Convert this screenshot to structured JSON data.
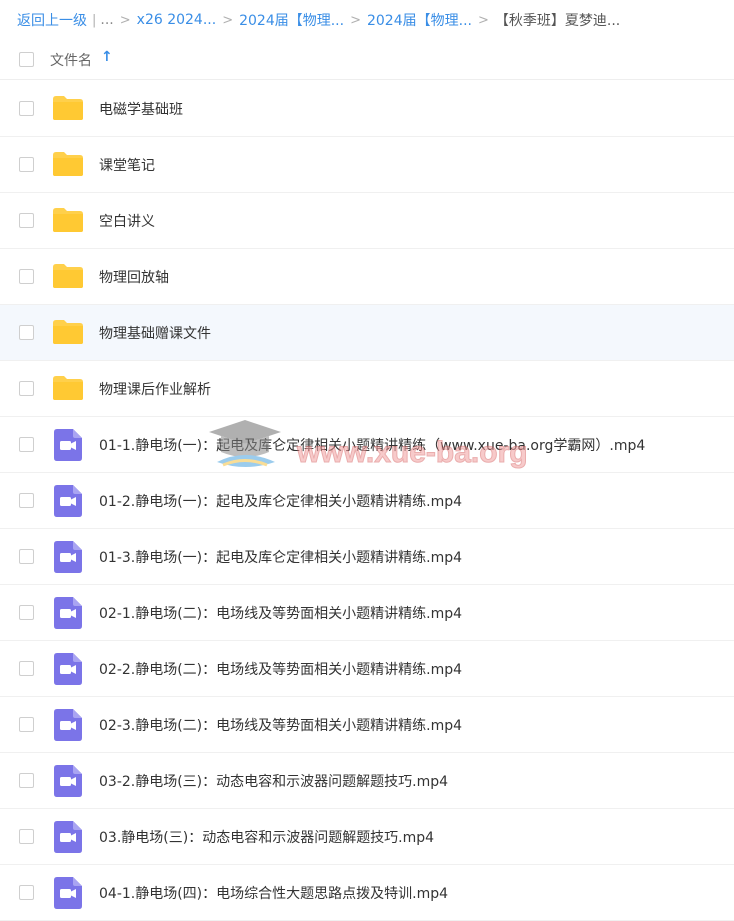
{
  "breadcrumb": {
    "back": "返回上一级",
    "ellipsis": "...",
    "items": [
      "x26 2024...",
      "2024届【物理...",
      "2024届【物理..."
    ],
    "current": "【秋季班】夏梦迪..."
  },
  "header": {
    "column_label": "文件名",
    "sort_icon": "arrow-up-icon"
  },
  "files": [
    {
      "type": "folder",
      "name": "电磁学基础班"
    },
    {
      "type": "folder",
      "name": "课堂笔记"
    },
    {
      "type": "folder",
      "name": "空白讲义"
    },
    {
      "type": "folder",
      "name": "物理回放轴"
    },
    {
      "type": "folder",
      "name": "物理基础赠课文件",
      "hover": true
    },
    {
      "type": "folder",
      "name": "物理课后作业解析"
    },
    {
      "type": "video",
      "name": "01-1.静电场(一)：起电及库仑定律相关小题精讲精练（www.xue-ba.org学霸网）.mp4"
    },
    {
      "type": "video",
      "name": "01-2.静电场(一)：起电及库仑定律相关小题精讲精练.mp4"
    },
    {
      "type": "video",
      "name": "01-3.静电场(一)：起电及库仑定律相关小题精讲精练.mp4"
    },
    {
      "type": "video",
      "name": "02-1.静电场(二)：电场线及等势面相关小题精讲精练.mp4"
    },
    {
      "type": "video",
      "name": "02-2.静电场(二)：电场线及等势面相关小题精讲精练.mp4"
    },
    {
      "type": "video",
      "name": "02-3.静电场(二)：电场线及等势面相关小题精讲精练.mp4"
    },
    {
      "type": "video",
      "name": "03-2.静电场(三)：动态电容和示波器问题解题技巧.mp4"
    },
    {
      "type": "video",
      "name": "03.静电场(三)：动态电容和示波器问题解题技巧.mp4"
    },
    {
      "type": "video",
      "name": "04-1.静电场(四)：电场综合性大题思路点拨及特训.mp4"
    }
  ],
  "watermark": {
    "text": "www.xue-ba.org"
  },
  "colors": {
    "link": "#3a8ee6",
    "folder": "#ffd04b",
    "video": "#7b74e8",
    "hover_row": "#f4f8fd"
  }
}
